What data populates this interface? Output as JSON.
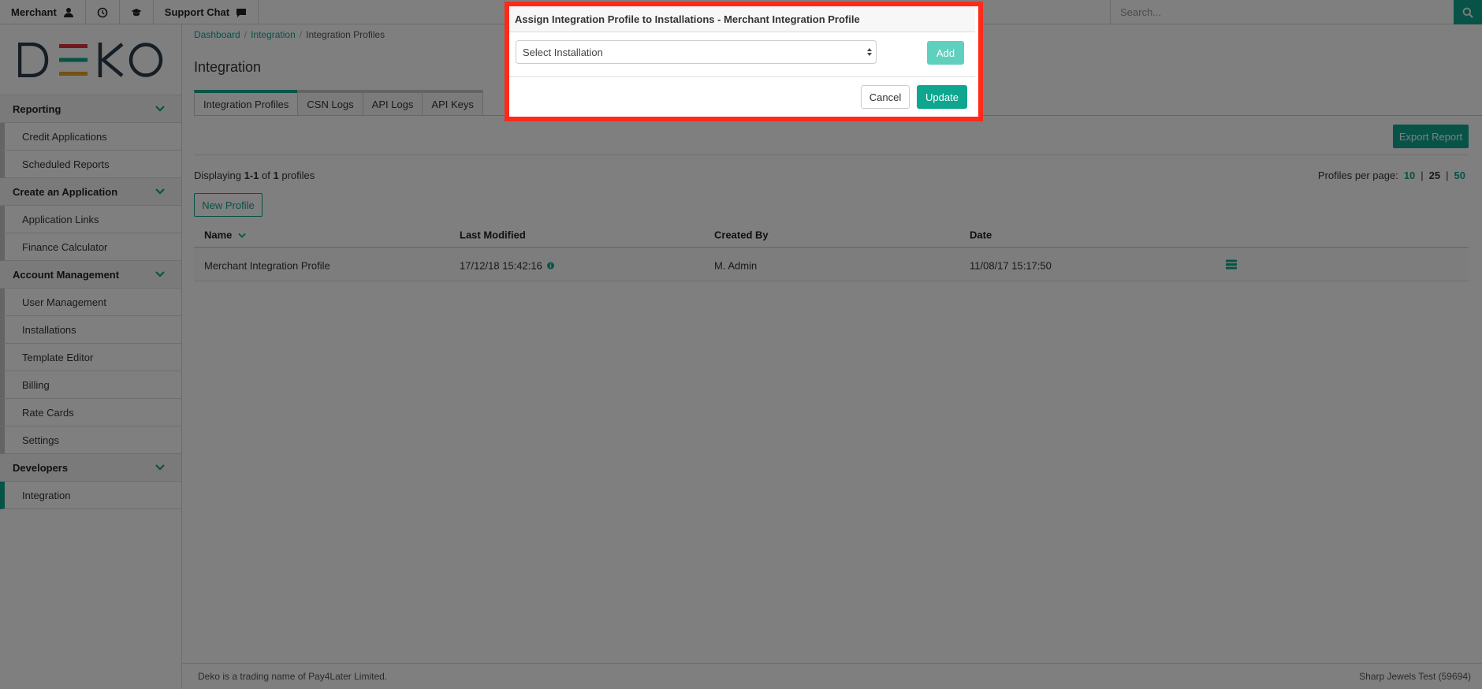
{
  "topbar": {
    "merchant_label": "Merchant",
    "support_label": "Support Chat",
    "search_placeholder": "Search..."
  },
  "brand": {
    "logo_text": "DEKO",
    "logo_colors": [
      "#2a3a4a",
      "#e0313f",
      "#0fa68f",
      "#e7a52a"
    ]
  },
  "sidebar": {
    "sections": [
      {
        "title": "Reporting",
        "items": [
          "Credit Applications",
          "Scheduled Reports"
        ]
      },
      {
        "title": "Create an Application",
        "items": [
          "Application Links",
          "Finance Calculator"
        ]
      },
      {
        "title": "Account Management",
        "items": [
          "User Management",
          "Installations",
          "Template Editor",
          "Billing",
          "Rate Cards",
          "Settings"
        ]
      },
      {
        "title": "Developers",
        "items": [
          "Integration"
        ]
      }
    ],
    "active_item": "Integration"
  },
  "breadcrumb": [
    "Dashboard",
    "Integration",
    "Integration Profiles"
  ],
  "page": {
    "title": "Integration",
    "tabs": [
      "Integration Profiles",
      "CSN Logs",
      "API Logs",
      "API Keys"
    ],
    "active_tab": "Integration Profiles",
    "export_label": "Export Report",
    "displaying_prefix": "Displaying ",
    "displaying_range": "1-1",
    "displaying_of": " of ",
    "displaying_count": "1",
    "displaying_suffix": " profiles",
    "per_page_label": "Profiles per page:",
    "per_page_options": [
      "10",
      "25",
      "50"
    ],
    "per_page_separator": "|",
    "per_page_current": "25",
    "new_profile_label": "New Profile"
  },
  "table": {
    "columns": [
      "Name",
      "Last Modified",
      "Created By",
      "Date"
    ],
    "rows": [
      {
        "name": "Merchant Integration Profile",
        "last_modified": "17/12/18 15:42:16",
        "created_by": "M. Admin",
        "date": "11/08/17 15:17:50"
      }
    ]
  },
  "footer": {
    "left": "Deko is a trading name of Pay4Later Limited.",
    "right": "Sharp Jewels Test (59694)"
  },
  "modal": {
    "title": "Assign Integration Profile to Installations - Merchant Integration Profile",
    "select_value": "Select Installation",
    "add_label": "Add",
    "cancel_label": "Cancel",
    "update_label": "Update"
  },
  "colors": {
    "accent": "#0fa68f",
    "highlight": "#ff2a1a"
  }
}
